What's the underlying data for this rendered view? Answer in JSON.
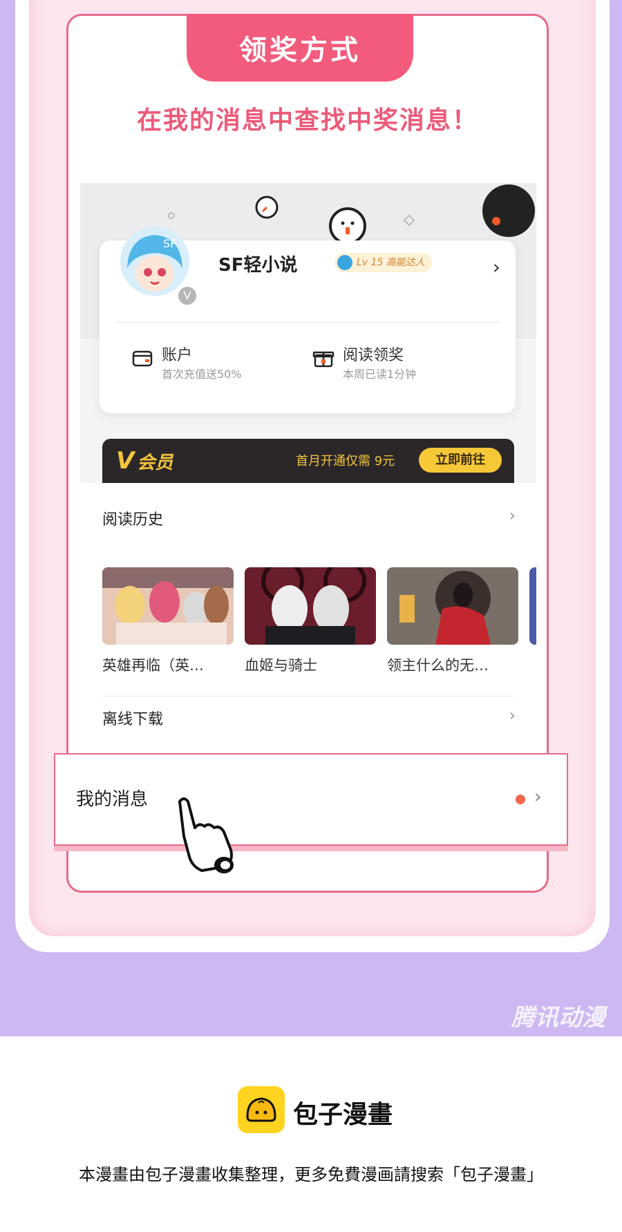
{
  "header": {
    "tab_label": "领奖方式",
    "subtitle": "在我的消息中查找中奖消息！"
  },
  "profile": {
    "username": "SF轻小说",
    "level_badge": "Lv 15 高能达人",
    "avatar_badge": "V",
    "arrow": "›"
  },
  "stats": [
    {
      "title": "账户",
      "sub": "首次充值送50%",
      "icon": "wallet-icon"
    },
    {
      "title": "阅读领奖",
      "sub": "本周已读1分钟",
      "icon": "gift-icon"
    }
  ],
  "vip": {
    "label_v": "V",
    "label": "会员",
    "promo": "首月开通仅需 9元",
    "button": "立即前往"
  },
  "reading_history": {
    "title": "阅读历史",
    "chevron": "›",
    "items": [
      {
        "title": "英雄再临（英…"
      },
      {
        "title": "血姬与骑士"
      },
      {
        "title": "领主什么的无…"
      }
    ]
  },
  "offline": {
    "title": "离线下载",
    "chevron": "›"
  },
  "messages": {
    "title": "我的消息",
    "chevron": "›"
  },
  "watermark": "腾讯动漫",
  "footer": {
    "logo_text": "包子漫畫",
    "note": "本漫畫由包子漫畫收集整理，更多免費漫画請搜索「包子漫畫」"
  },
  "colors": {
    "accent": "#f25b7c",
    "vip_gold": "#f3c53b",
    "bg_purple": "#cdb8f2",
    "notify": "#f0694b"
  }
}
